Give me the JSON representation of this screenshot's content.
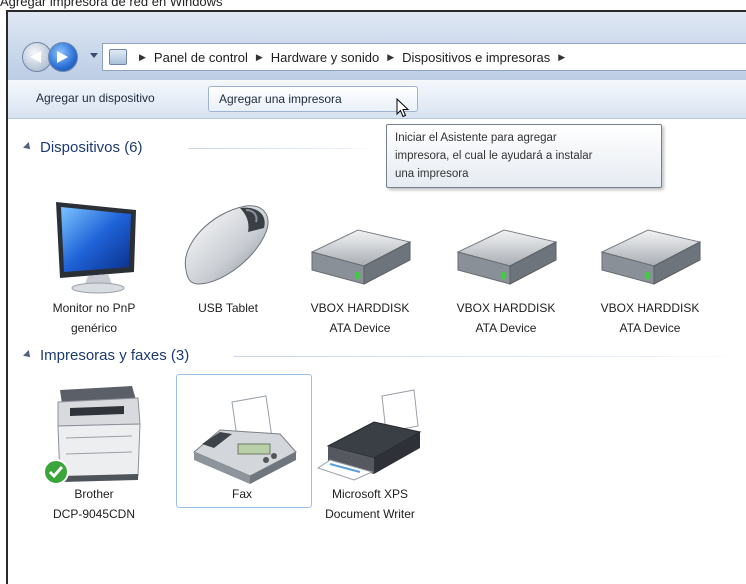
{
  "caption": "Agregar impresora de red en Windows",
  "breadcrumb": [
    "Panel de control",
    "Hardware y sonido",
    "Dispositivos e impresoras"
  ],
  "commands": {
    "add_device": "Agregar un dispositivo",
    "add_printer": "Agregar una impresora"
  },
  "tooltip": {
    "lines": [
      "Iniciar el Asistente para agregar",
      "impresora, el cual le ayudará a instalar",
      "una impresora"
    ]
  },
  "groups": {
    "devices": {
      "title": "Dispositivos (6)",
      "items": [
        {
          "line1": "Monitor no PnP",
          "line2": "genérico",
          "icon": "monitor-icon"
        },
        {
          "line1": "USB Tablet",
          "line2": "",
          "icon": "mouse-icon"
        },
        {
          "line1": "VBOX HARDDISK",
          "line2": "ATA Device",
          "icon": "harddisk-icon"
        },
        {
          "line1": "VBOX HARDDISK",
          "line2": "ATA Device",
          "icon": "harddisk-icon"
        },
        {
          "line1": "VBOX HARDDISK",
          "line2": "ATA Device",
          "icon": "harddisk-icon"
        }
      ]
    },
    "printers": {
      "title": "Impresoras y faxes (3)",
      "items": [
        {
          "line1": "Brother",
          "line2": "DCP-9045CDN",
          "icon": "multifunction-printer-icon",
          "default": true
        },
        {
          "line1": "Fax",
          "line2": "",
          "icon": "fax-icon",
          "selected": true
        },
        {
          "line1": "Microsoft XPS",
          "line2": "Document Writer",
          "icon": "printer-icon"
        }
      ]
    }
  },
  "colors": {
    "group_title": "#1d3a6e",
    "selection_border": "#9cc0e8",
    "default_check": "#3aa63a"
  }
}
